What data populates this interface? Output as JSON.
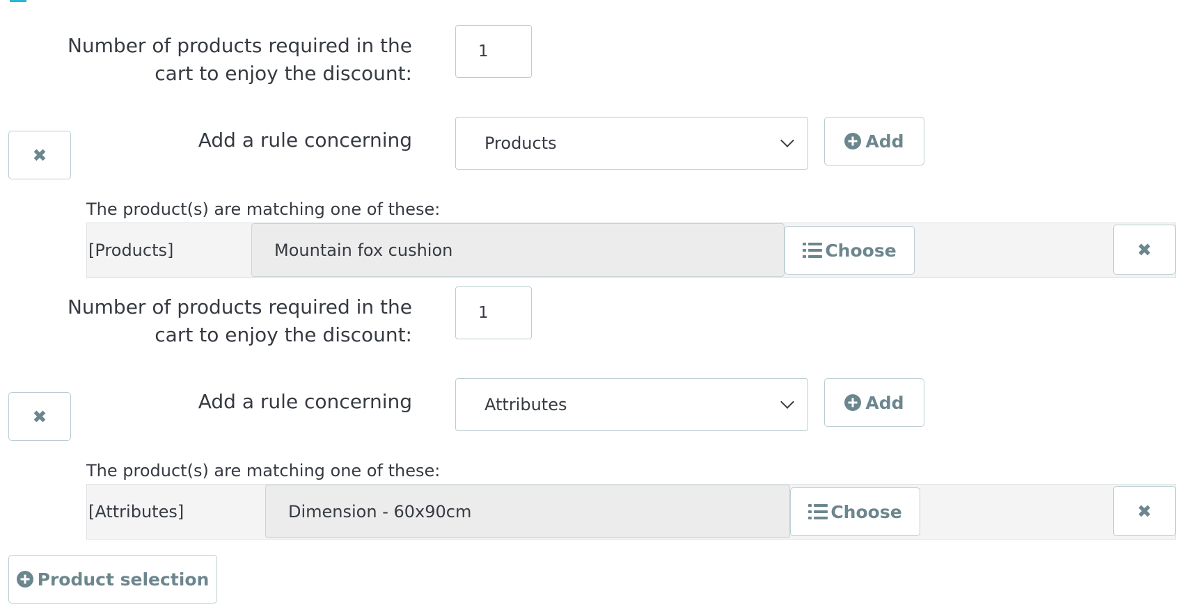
{
  "groups": [
    {
      "qty_label_line1": "Number of products required in the",
      "qty_label_line2": "cart to enjoy the discount:",
      "qty_value": "1",
      "rule_label": "Add a rule concerning",
      "rule_select_value": "Products",
      "add_label": "Add",
      "matching_label": "The product(s) are matching one of these:",
      "rule_type": "[Products]",
      "rule_value": "Mountain fox cushion",
      "choose_label": "Choose"
    },
    {
      "qty_label_line1": "Number of products required in the",
      "qty_label_line2": "cart to enjoy the discount:",
      "qty_value": "1",
      "rule_label": "Add a rule concerning",
      "rule_select_value": "Attributes",
      "add_label": "Add",
      "matching_label": "The product(s) are matching one of these:",
      "rule_type": "[Attributes]",
      "rule_value": "Dimension - 60x90cm",
      "choose_label": "Choose"
    }
  ],
  "product_selection_label": "Product selection",
  "icons": {
    "remove": "close-icon",
    "add": "plus-circle-icon",
    "choose": "list-icon"
  },
  "colors": {
    "text": "#363a41",
    "button_text": "#6c868e",
    "border": "#bbcdd2",
    "panel_bg": "#f4f4f4",
    "accent": "#25b9d7"
  }
}
